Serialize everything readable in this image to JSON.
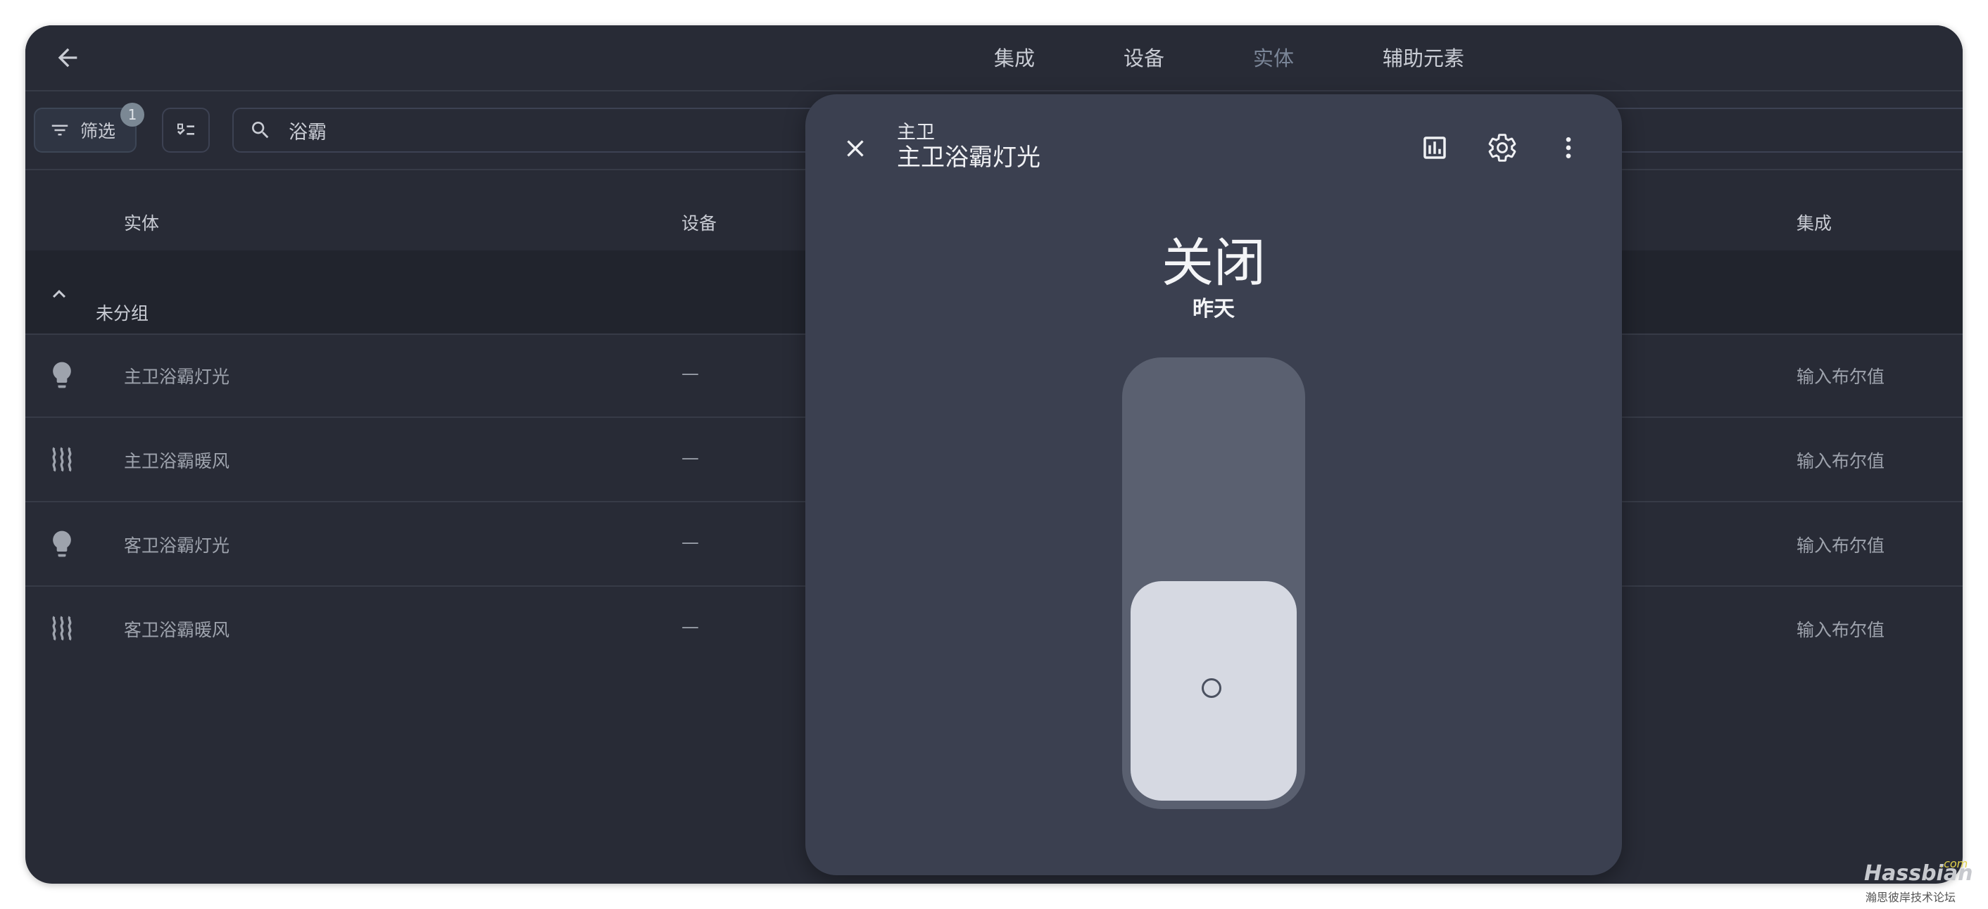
{
  "tabs": [
    {
      "label": "集成"
    },
    {
      "label": "设备"
    },
    {
      "label": "实体"
    },
    {
      "label": "辅助元素"
    }
  ],
  "toolbar": {
    "filter_label": "筛选",
    "filter_count": "1",
    "search_value": "浴霸"
  },
  "table": {
    "headers": {
      "entity": "实体",
      "device": "设备",
      "integration": "集成"
    },
    "group_label": "未分组",
    "rows": [
      {
        "icon": "lightbulb-icon",
        "name": "主卫浴霸灯光",
        "device": "—",
        "integration": "输入布尔值"
      },
      {
        "icon": "heat-wave-icon",
        "name": "主卫浴霸暖风",
        "device": "—",
        "integration": "输入布尔值"
      },
      {
        "icon": "lightbulb-icon",
        "name": "客卫浴霸灯光",
        "device": "—",
        "integration": "输入布尔值"
      },
      {
        "icon": "heat-wave-icon",
        "name": "客卫浴霸暖风",
        "device": "—",
        "integration": "输入布尔值"
      }
    ]
  },
  "dialog": {
    "area": "主卫",
    "title": "主卫浴霸灯光",
    "state": "关闭",
    "last_changed": "昨天",
    "toggle_on": false
  },
  "watermark": {
    "brand": "Hassbian",
    "domain": ".com",
    "subtitle": "瀚思彼岸技术论坛"
  },
  "colors": {
    "background": "#282b36",
    "dialog": "#3b4050",
    "toggle_track": "#5a6070",
    "toggle_knob": "#d6d9e2"
  }
}
